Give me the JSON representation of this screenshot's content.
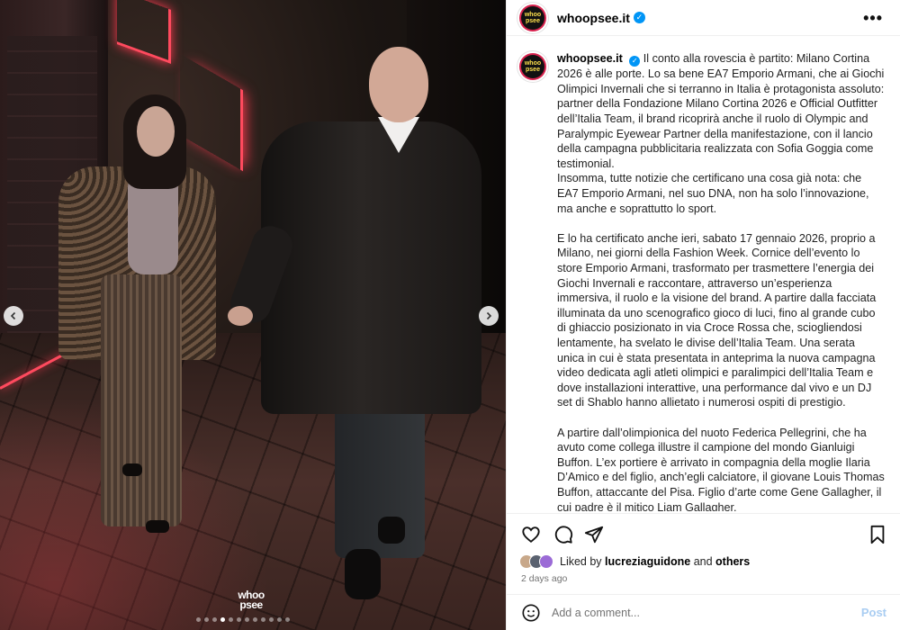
{
  "account": {
    "username": "whoopsee.it",
    "avatar_text_1": "whoo",
    "avatar_text_2": "psee",
    "verified": true
  },
  "media": {
    "watermark_line1": "whoo",
    "watermark_line2": "psee",
    "prev_icon": "chevron-left-icon",
    "next_icon": "chevron-right-icon",
    "carousel_count": 12,
    "carousel_active": 3
  },
  "caption": {
    "p1": "Il conto alla rovescia è partito: Milano Cortina 2026 è alle porte. Lo sa bene EA7 Emporio Armani, che ai Giochi Olimpici Invernali che si terranno in Italia è protagonista assoluto: partner della Fondazione Milano Cortina 2026 e Official Outfitter dell’Italia Team, il brand ricoprirà anche il ruolo di Olympic and Paralympic Eyewear Partner della manifestazione, con il lancio della campagna pubblicitaria realizzata con Sofia Goggia come testimonial.",
    "p1b": "Insomma, tutte notizie che certificano una cosa già nota: che EA7 Emporio Armani, nel suo DNA, non ha solo l’innovazione, ma anche e soprattutto lo sport.",
    "p2": "E lo ha certificato anche ieri, sabato 17 gennaio 2026, proprio a Milano, nei giorni della Fashion Week. Cornice dell’evento lo store Emporio Armani, trasformato per trasmettere l’energia dei Giochi Invernali e raccontare, attraverso un’esperienza immersiva, il ruolo e la visione del brand. A partire dalla facciata illuminata da uno scenografico gioco di luci, fino al grande cubo di ghiaccio posizionato in via Croce Rossa che, sciogliendosi lentamente, ha svelato le divise dell’Italia Team. Una serata unica in cui è stata presentata in anteprima la nuova campagna video dedicata agli atleti olimpici e paralimpici dell’Italia Team e dove installazioni interattive, una performance dal vivo e un DJ set di Shablo hanno allietato i numerosi ospiti di prestigio.",
    "p3": "A partire dall’olimpionica del nuoto Federica Pellegrini, che ha avuto come collega illustre il campione del mondo Gianluigi Buffon. L’ex portiere è arrivato in compagnia della moglie Ilaria D’Amico e del figlio, anch’egli calciatore, il giovane Louis Thomas Buffon, attaccante del Pisa. Figlio d’arte come Gene Gallagher, il cui padre è il mitico Liam Gallagher."
  },
  "actions": {
    "like_icon": "heart-icon",
    "comment_icon": "comment-icon",
    "share_icon": "share-icon",
    "save_icon": "bookmark-icon"
  },
  "likes": {
    "prefix": "Liked by",
    "user": "lucreziaguidone",
    "conjunction": "and",
    "others": "others"
  },
  "timestamp": "2 days ago",
  "comment_box": {
    "placeholder": "Add a comment...",
    "post_label": "Post"
  },
  "colors": {
    "verified": "#0095f6",
    "post_disabled": "#a9cdf2",
    "avatar_ring": "#d9234f"
  }
}
